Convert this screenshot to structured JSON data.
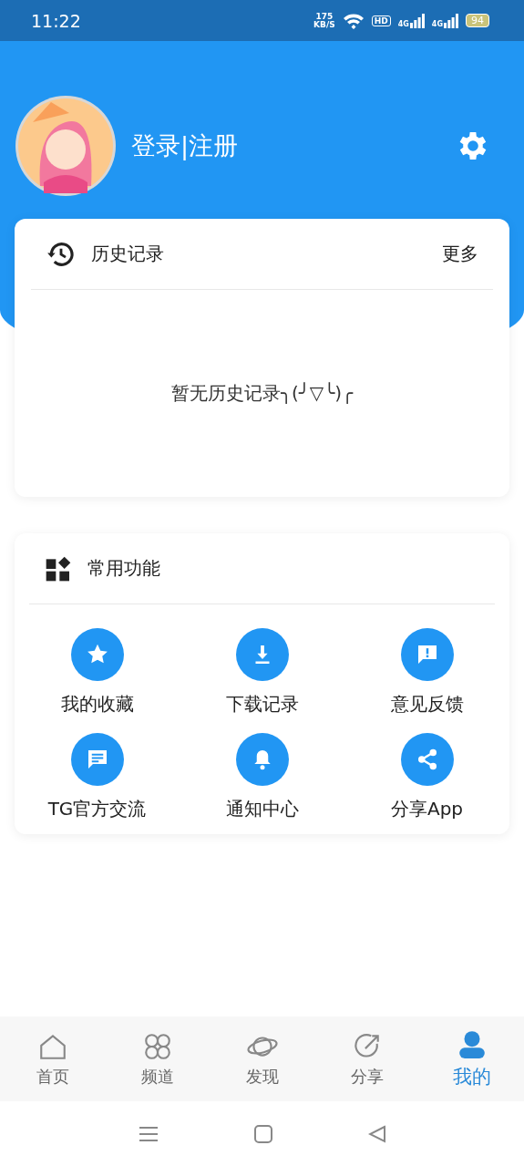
{
  "status_bar": {
    "time": "11:22",
    "net_speed": "175",
    "net_unit": "KB/S",
    "hd": "HD",
    "signals": [
      "4G",
      "4G"
    ],
    "battery": "94"
  },
  "profile": {
    "login_text": "登录|注册"
  },
  "history": {
    "title": "历史记录",
    "more": "更多",
    "empty_text": "暂无历史记录╮(╯▽╰)╭"
  },
  "functions": {
    "title": "常用功能",
    "items": [
      {
        "kind": "star",
        "label": "我的收藏"
      },
      {
        "kind": "download",
        "label": "下载记录"
      },
      {
        "kind": "feedback",
        "label": "意见反馈"
      },
      {
        "kind": "chat",
        "label": "TG官方交流"
      },
      {
        "kind": "bell",
        "label": "通知中心"
      },
      {
        "kind": "share",
        "label": "分享App"
      }
    ]
  },
  "tabs": [
    {
      "kind": "home",
      "label": "首页",
      "selected": false
    },
    {
      "kind": "channel",
      "label": "频道",
      "selected": false
    },
    {
      "kind": "discover",
      "label": "发现",
      "selected": false
    },
    {
      "kind": "share",
      "label": "分享",
      "selected": false
    },
    {
      "kind": "me",
      "label": "我的",
      "selected": true
    }
  ]
}
